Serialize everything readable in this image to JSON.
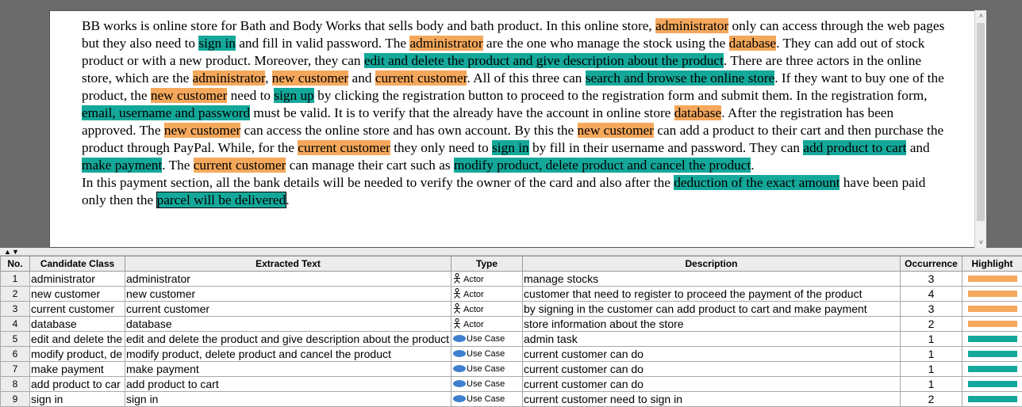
{
  "document": {
    "paragraphs": [
      [
        {
          "t": "BB works is online store for Bath and Body Works that sells body and bath product. In this online store, "
        },
        {
          "t": "administrator",
          "hl": "orange"
        },
        {
          "t": " only can access through the web pages but they also need to "
        },
        {
          "t": "sign in",
          "hl": "teal"
        },
        {
          "t": " and fill in valid password. The "
        },
        {
          "t": "administrator",
          "hl": "orange"
        },
        {
          "t": " are the one who manage the stock using the "
        },
        {
          "t": "database",
          "hl": "orange"
        },
        {
          "t": ". They can add out of stock product or with a new product. Moreover, they can "
        },
        {
          "t": "edit and delete the product and give description about the product",
          "hl": "teal"
        },
        {
          "t": ". There are three actors in the online store, which are the "
        },
        {
          "t": "administrator",
          "hl": "orange"
        },
        {
          "t": ", "
        },
        {
          "t": "new customer",
          "hl": "orange"
        },
        {
          "t": " and "
        },
        {
          "t": "current customer",
          "hl": "orange"
        },
        {
          "t": ". All of this three can "
        },
        {
          "t": "search and browse the online store",
          "hl": "teal"
        },
        {
          "t": ". If they want to buy one of the product, the "
        },
        {
          "t": "new customer",
          "hl": "orange"
        },
        {
          "t": " need to "
        },
        {
          "t": "sign up",
          "hl": "teal"
        },
        {
          "t": " by clicking the registration button to proceed to the registration form and submit them. In the registration form, "
        },
        {
          "t": "email, username and password",
          "hl": "teal"
        },
        {
          "t": " must be valid. It is to verify that the already have the account in online store "
        },
        {
          "t": "database",
          "hl": "orange"
        },
        {
          "t": ". After the registration has been approved. The "
        },
        {
          "t": "new customer",
          "hl": "orange"
        },
        {
          "t": " can access the online store and has own account. By this the "
        },
        {
          "t": "new customer",
          "hl": "orange"
        },
        {
          "t": " can add a product to their cart and then purchase the product through PayPal. While, for the "
        },
        {
          "t": "current customer",
          "hl": "orange"
        },
        {
          "t": " they only need to "
        },
        {
          "t": "sign in",
          "hl": "teal"
        },
        {
          "t": " by fill in their username and password. They can "
        },
        {
          "t": "add product to cart",
          "hl": "teal"
        },
        {
          "t": " and "
        },
        {
          "t": "make payment",
          "hl": "teal"
        },
        {
          "t": ". The "
        },
        {
          "t": "current customer",
          "hl": "orange"
        },
        {
          "t": " can manage their cart such as "
        },
        {
          "t": "modify product, delete product and cancel the product",
          "hl": "teal"
        },
        {
          "t": "."
        }
      ],
      [
        {
          "t": "In this payment section, all the bank details will be needed to verify the owner of the card and also after the "
        },
        {
          "t": "deduction of the exact amount",
          "hl": "teal"
        },
        {
          "t": " have been paid only then the "
        },
        {
          "t": "parcel will be delivered",
          "hl": "teal",
          "boxed": true
        },
        {
          "t": "."
        }
      ]
    ]
  },
  "scrollbar": {
    "up_glyph": "˄",
    "down_glyph": "˅"
  },
  "splitter": {
    "up_glyph": "▲",
    "down_glyph": "▼"
  },
  "colors": {
    "actor_highlight": "#f5a85c",
    "usecase_highlight": "#14a89a",
    "usecase_icon": "#3f7fcf"
  },
  "table": {
    "columns": [
      "No.",
      "Candidate Class",
      "Extracted Text",
      "Type",
      "Description",
      "Occurrence",
      "Highlight"
    ],
    "rows": [
      {
        "no": "1",
        "candidate": "administrator",
        "extracted": "administrator",
        "type": "Actor",
        "icon": "actor-icon",
        "description": "manage stocks",
        "occurrence": "3",
        "highlight": "#f5a85c"
      },
      {
        "no": "2",
        "candidate": "new customer",
        "extracted": "new customer",
        "type": "Actor",
        "icon": "actor-icon",
        "description": "customer that need to register to proceed the payment of the product",
        "occurrence": "4",
        "highlight": "#f5a85c"
      },
      {
        "no": "3",
        "candidate": "current customer",
        "extracted": "current customer",
        "type": "Actor",
        "icon": "actor-icon",
        "description": "by signing in the customer can add product to cart and make payment",
        "occurrence": "3",
        "highlight": "#f5a85c"
      },
      {
        "no": "4",
        "candidate": "database",
        "extracted": "database",
        "type": "Actor",
        "icon": "actor-icon",
        "description": "store information about the store",
        "occurrence": "2",
        "highlight": "#f5a85c"
      },
      {
        "no": "5",
        "candidate": "edit and delete the",
        "extracted": "edit and delete the product and give description about the product",
        "type": "Use Case",
        "icon": "use-case-icon",
        "description": "admin task",
        "occurrence": "1",
        "highlight": "#14a89a"
      },
      {
        "no": "6",
        "candidate": "modify product, de",
        "extracted": "modify product, delete product and cancel the product",
        "type": "Use Case",
        "icon": "use-case-icon",
        "description": "current customer can do",
        "occurrence": "1",
        "highlight": "#14a89a"
      },
      {
        "no": "7",
        "candidate": "make payment",
        "extracted": "make payment",
        "type": "Use Case",
        "icon": "use-case-icon",
        "description": "current customer can do",
        "occurrence": "1",
        "highlight": "#14a89a"
      },
      {
        "no": "8",
        "candidate": "add product to car",
        "extracted": "add product to cart",
        "type": "Use Case",
        "icon": "use-case-icon",
        "description": "current customer can do",
        "occurrence": "1",
        "highlight": "#14a89a"
      },
      {
        "no": "9",
        "candidate": "sign in",
        "extracted": "sign in",
        "type": "Use Case",
        "icon": "use-case-icon",
        "description": "current customer need to sign in",
        "occurrence": "2",
        "highlight": "#14a89a"
      }
    ]
  }
}
